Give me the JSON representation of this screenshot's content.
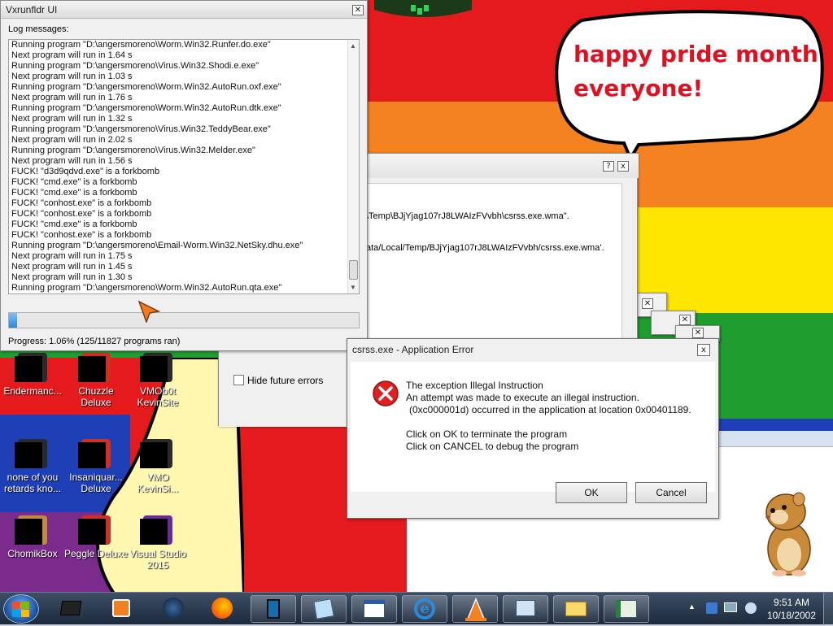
{
  "log_window": {
    "title": "Vxrunfldr UI",
    "log_label": "Log messages:",
    "lines": [
      "Running program \"D:\\angersmoreno\\Worm.Win32.Runfer.do.exe\"",
      "Next program will run in 1.64 s",
      "Running program \"D:\\angersmoreno\\Virus.Win32.Shodi.e.exe\"",
      "Next program will run in 1.03 s",
      "Running program \"D:\\angersmoreno\\Worm.Win32.AutoRun.oxf.exe\"",
      "Next program will run in 1.76 s",
      "Running program \"D:\\angersmoreno\\Worm.Win32.AutoRun.dtk.exe\"",
      "Next program will run in 1.32 s",
      "Running program \"D:\\angersmoreno\\Virus.Win32.TeddyBear.exe\"",
      "Next program will run in 2.02 s",
      "Running program \"D:\\angersmoreno\\Virus.Win32.Melder.exe\"",
      "Next program will run in 1.56 s",
      "FUCK! \"d3d9qdvd.exe\" is a forkbomb",
      "FUCK! \"cmd.exe\" is a forkbomb",
      "FUCK! \"cmd.exe\" is a forkbomb",
      "FUCK! \"conhost.exe\" is a forkbomb",
      "FUCK! \"conhost.exe\" is a forkbomb",
      "FUCK! \"cmd.exe\" is a forkbomb",
      "FUCK! \"conhost.exe\" is a forkbomb",
      "Running program \"D:\\angersmoreno\\Email-Worm.Win32.NetSky.dhu.exe\"",
      "Next program will run in 1.75 s",
      "Next program will run in 1.45 s",
      "Next program will run in 1.30 s",
      "Running program \"D:\\angersmoreno\\Worm.Win32.AutoRun.qta.exe\""
    ],
    "progress_fraction": 0.0106,
    "progress_text": "Progress: 1.06% (125/11827 programs ran)"
  },
  "bg_dialog": {
    "line1": "\\Temp\\BJjYjag107rJ8LWAIzFVvbh\\csrss.exe.wma\".",
    "line2": "ata/Local/Temp/BJjYjag107rJ8LWAIzFVvbh/csrss.exe.wma'.",
    "help_btn": "?",
    "close_btn": "x",
    "hide_errors": "Hide future errors"
  },
  "error_dialog": {
    "title": "csrss.exe - Application Error",
    "line1": "The exception Illegal Instruction",
    "line2": "An attempt was made to execute an illegal instruction.",
    "line3": "(0xc000001d) occurred in the application at location 0x00401189.",
    "line4": "Click on OK to terminate the program",
    "line5": "Click on CANCEL to debug the program",
    "ok": "OK",
    "cancel": "Cancel",
    "close_btn": "x"
  },
  "speech_bubble": {
    "line1": "happy pride month",
    "line2": "everyone!"
  },
  "desktop_icons": [
    {
      "label1": "Endermanc...",
      "label2": "",
      "icon": "app-icon"
    },
    {
      "label1": "Chuzzle",
      "label2": "Deluxe",
      "icon": "game-icon"
    },
    {
      "label1": "VMOb0t",
      "label2": "KevinSite",
      "icon": "app-icon"
    },
    {
      "label1": "none of you",
      "label2": "retards kno...",
      "icon": "app-icon"
    },
    {
      "label1": "Insaniquar...",
      "label2": "Deluxe",
      "icon": "game-icon"
    },
    {
      "label1": "VMO",
      "label2": "KevinSi...",
      "icon": "app-icon"
    },
    {
      "label1": "ChomikBox",
      "label2": "",
      "icon": "hamster-icon"
    },
    {
      "label1": "Peggle Deluxe",
      "label2": "",
      "icon": "game-icon"
    },
    {
      "label1": "Visual Studio",
      "label2": "2015",
      "icon": "visual-studio-icon"
    }
  ],
  "taskbar": {
    "time": "9:51 AM",
    "date": "10/18/2002"
  },
  "colors": {
    "red": "#e41a1c",
    "orange": "#f58220",
    "yellow": "#ffe600",
    "green": "#1f9e2f",
    "blue": "#1e3fb5",
    "purple": "#7a2b8c",
    "bubble_text": "#e01020"
  }
}
